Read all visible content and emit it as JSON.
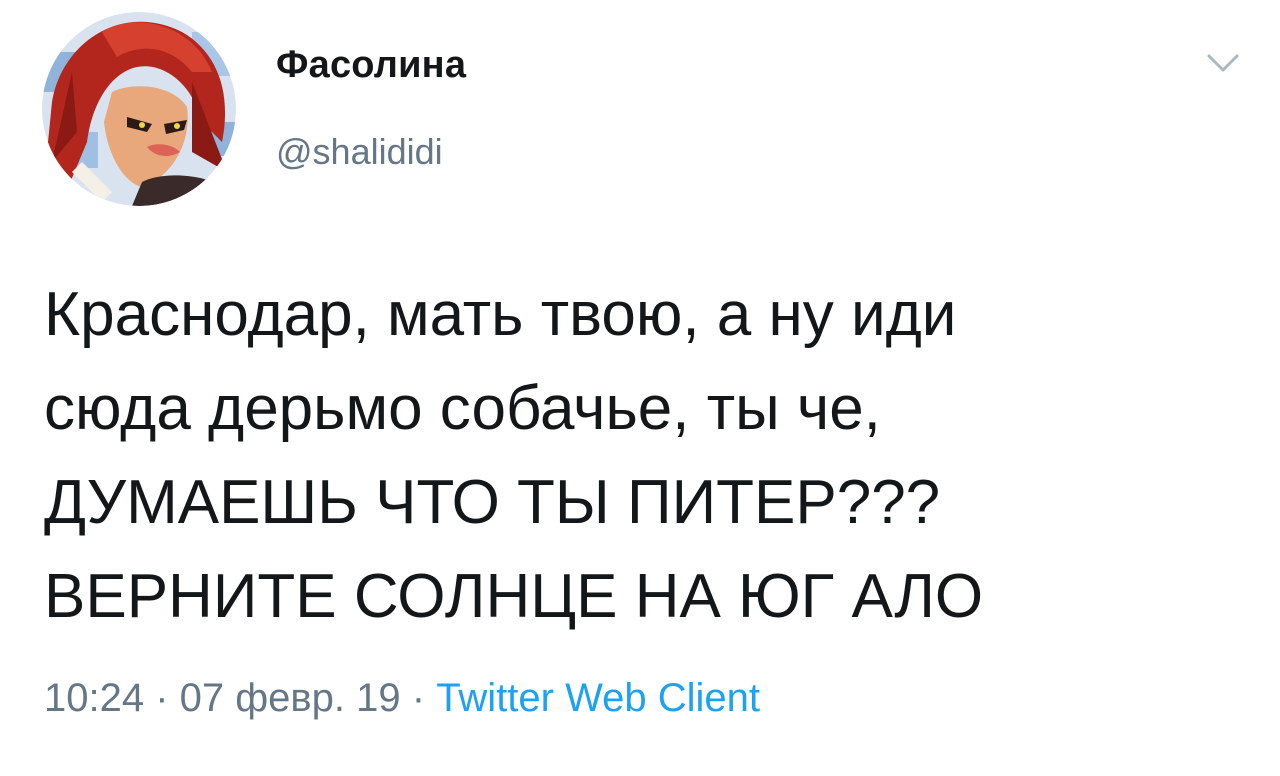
{
  "user": {
    "display_name": "Фасолина",
    "handle": "@shalididi",
    "avatar_icon": "anime-avatar-icon"
  },
  "tweet": {
    "lines": [
      "Краснодар, мать твою, а ну иди",
      "сюда дерьмо собачье, ты че,",
      "ДУМАЕШЬ ЧТО ТЫ ПИТЕР???",
      "ВЕРНИТЕ СОЛНЦЕ НА ЮГ АЛО"
    ]
  },
  "meta": {
    "time": "10:24",
    "separator": " · ",
    "date": "07 февр. 19",
    "separator2": " · ",
    "client": "Twitter Web Client"
  },
  "icons": {
    "menu": "chevron-down-icon"
  },
  "colors": {
    "text": "#14171a",
    "secondary": "#657786",
    "link": "#1da1f2"
  }
}
